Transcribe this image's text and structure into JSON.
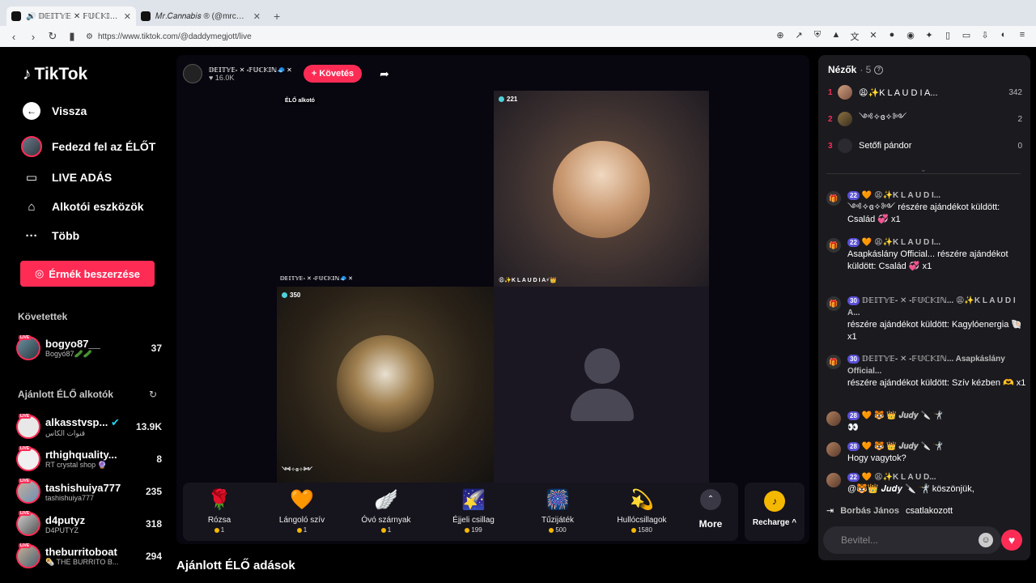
{
  "browser": {
    "tabs": [
      {
        "title": "🔊 𝔻𝔼𝕀𝕋𝕐𝔼 ✕ 𝔽𝕌ℂ𝕂𝕀ℕ 🧢✕ (@da"
      },
      {
        "title": "𝑀𝑟.𝐶𝑎𝑛𝑛𝑎𝑏𝑖𝑠 ® (@mrcannabis_)"
      }
    ],
    "url": "https://www.tiktok.com/@daddymegjott/live"
  },
  "sidebar": {
    "logo": "TikTok",
    "nav": [
      {
        "label": "Vissza"
      },
      {
        "label": "Fedezd fel az ÉLŐT"
      },
      {
        "label": "LIVE ADÁS"
      },
      {
        "label": "Alkotói eszközök"
      },
      {
        "label": "Több"
      }
    ],
    "coins_button": "Érmék beszerzése",
    "following_title": "Követettek",
    "following": [
      {
        "name": "bogyo87__",
        "sub": "Bogyó87🥒🥒",
        "count": "37"
      }
    ],
    "recommended_title": "Ajánlott ÉLŐ alkotók",
    "recommended": [
      {
        "name": "alkasstvsp...",
        "sub": "قنوات الكاس",
        "count": "13.9K"
      },
      {
        "name": "rthighquality...",
        "sub": "RT crystal shop 🔮",
        "count": "8"
      },
      {
        "name": "tashishuiya777",
        "sub": "tashishuiya777",
        "count": "235"
      },
      {
        "name": "d4putyz",
        "sub": "D4PUTYZ",
        "count": "318"
      },
      {
        "name": "theburritoboat",
        "sub": "🌯 THE BURRITO B...",
        "count": "294"
      }
    ]
  },
  "stream": {
    "host_name": "𝔻𝔼𝕀𝕋𝕐𝔼- ✕ -𝔽𝕌ℂ𝕂𝕀ℕ🧢 ✕",
    "host_likes": "16.0K",
    "follow_label": "+ Követés",
    "creator_tag": "ÉLŐ alkotó",
    "tiles": [
      {
        "count": "221",
        "name": "😩✨K L A U D I A⚡👑"
      },
      {
        "count": "350",
        "name": "𝔻𝔼𝕀𝕋𝕐𝔼- ✕ -𝔽𝕌ℂ𝕂𝕀ℕ🧢 ✕",
        "bottom_name": "༺✧ɞ✧༻"
      }
    ]
  },
  "gifts": [
    {
      "icon": "🌹",
      "name": "Rózsa",
      "price": "1"
    },
    {
      "icon": "🧡",
      "name": "Lángoló szív",
      "price": "1"
    },
    {
      "icon": "🪽",
      "name": "Óvó szárnyak",
      "price": "1"
    },
    {
      "icon": "🌠",
      "name": "Éjjeli csillag",
      "price": "199"
    },
    {
      "icon": "🎆",
      "name": "Tűzijáték",
      "price": "500"
    },
    {
      "icon": "💫",
      "name": "Hullócsillagok",
      "price": "1580"
    }
  ],
  "more_label": "More",
  "recharge_label": "Recharge ^",
  "recommended_live_title": "Ajánlott ÉLŐ adások",
  "chat": {
    "viewers_title": "Nézők",
    "viewers_count": "· 5",
    "viewers": [
      {
        "rank": "1",
        "name": "😩✨K L A U D I A...",
        "score": "342"
      },
      {
        "rank": "2",
        "name": "༺✧ɞ✧༻",
        "score": "2"
      },
      {
        "rank": "3",
        "name": "Setőfi pándor",
        "score": "0"
      }
    ],
    "messages": [
      {
        "level": "22",
        "sender": "🧡 😩✨K L A U D I...",
        "text": "༺✧ɞ✧༻ részére ajándékot küldött: Család 💞 x1"
      },
      {
        "level": "22",
        "sender": "🧡 😩✨K L A U D I...",
        "text": "Asapkáslány Official... részére ajándékot küldött: Család 💞 x1"
      },
      {
        "level": "30",
        "sender": "𝔻𝔼𝕀𝕋𝕐𝔼- ✕ -𝔽𝕌ℂ𝕂𝕀ℕ... 😩✨K L A U D I A...",
        "text": "részére ajándékot küldött: Kagylóenergia 🐚 x1"
      },
      {
        "level": "30",
        "sender": "𝔻𝔼𝕀𝕋𝕐𝔼- ✕ -𝔽𝕌ℂ𝕂𝕀ℕ... Asapkáslány Official...",
        "text": "részére ajándékot küldött: Szív kézben 🫶 x1"
      },
      {
        "level": "28",
        "sender": "🧡 🐯 👑 𝑱𝒖𝒅𝒚 🔪 🤺",
        "text": "👀"
      },
      {
        "level": "28",
        "sender": "🧡 🐯 👑 𝑱𝒖𝒅𝒚 🔪 🤺",
        "text": "Hogy vagytok?"
      },
      {
        "level": "22",
        "sender": "🧡 😩✨K L A U D...",
        "text": "@🐯👑 𝑱𝒖𝒅𝒚 🔪 🤺 köszönjük,"
      }
    ],
    "join_user": "Borbás János",
    "join_text": "csatlakozott",
    "input_placeholder": "Bevitel..."
  }
}
